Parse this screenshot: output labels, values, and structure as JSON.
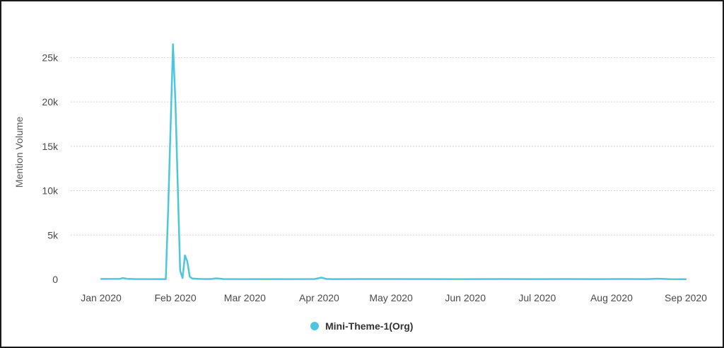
{
  "chart_data": {
    "type": "line",
    "title": "",
    "xlabel": "",
    "ylabel": "Mention Volume",
    "x_type": "date",
    "x_ticks": [
      "Jan 2020",
      "Feb 2020",
      "Mar 2020",
      "Apr 2020",
      "May 2020",
      "Jun 2020",
      "Jul 2020",
      "Aug 2020",
      "Sep 2020"
    ],
    "x_tick_dates": [
      "2020-01-01",
      "2020-02-01",
      "2020-03-01",
      "2020-04-01",
      "2020-05-01",
      "2020-06-01",
      "2020-07-01",
      "2020-08-01",
      "2020-09-01"
    ],
    "xlim": [
      "2020-01-01",
      "2020-09-01"
    ],
    "ylim": [
      0,
      27500
    ],
    "y_ticks": [
      0,
      5000,
      10000,
      15000,
      20000,
      25000
    ],
    "y_tick_labels": [
      "0",
      "5k",
      "10k",
      "15k",
      "20k",
      "25k"
    ],
    "grid": "horizontal dotted",
    "legend": "bottom-center",
    "series": [
      {
        "name": "Mini-Theme-1(Org)",
        "color": "#4cc6dc",
        "x": [
          "2020-01-01",
          "2020-01-09",
          "2020-01-10",
          "2020-01-12",
          "2020-01-15",
          "2020-01-28",
          "2020-01-29",
          "2020-01-31",
          "2020-02-01",
          "2020-02-03",
          "2020-02-04",
          "2020-02-05",
          "2020-02-06",
          "2020-02-07",
          "2020-02-08",
          "2020-02-11",
          "2020-02-16",
          "2020-02-18",
          "2020-02-21",
          "2020-03-08",
          "2020-03-30",
          "2020-04-02",
          "2020-04-04",
          "2020-04-07",
          "2020-05-02",
          "2020-06-01",
          "2020-06-16",
          "2020-07-01",
          "2020-07-13",
          "2020-07-25",
          "2020-08-03",
          "2020-08-16",
          "2020-08-20",
          "2020-08-25",
          "2020-09-01"
        ],
        "y": [
          50,
          60,
          150,
          60,
          40,
          30,
          8000,
          26500,
          20000,
          1000,
          150,
          2700,
          2000,
          300,
          100,
          50,
          40,
          120,
          40,
          30,
          40,
          200,
          50,
          30,
          40,
          30,
          40,
          30,
          40,
          30,
          40,
          30,
          80,
          30,
          20
        ]
      }
    ]
  }
}
